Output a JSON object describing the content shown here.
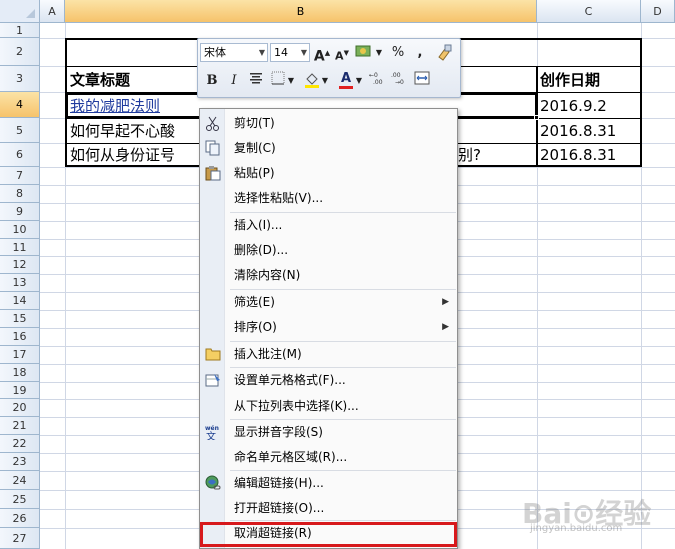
{
  "columns": [
    "A",
    "B",
    "C",
    "D"
  ],
  "selected_column": "B",
  "rows": [
    "1",
    "2",
    "3",
    "4",
    "5",
    "6",
    "7",
    "8",
    "9",
    "10",
    "11",
    "12",
    "13",
    "14",
    "15",
    "16",
    "17",
    "18",
    "19",
    "20",
    "21",
    "22",
    "23",
    "24",
    "25",
    "26",
    "27"
  ],
  "selected_row": "4",
  "table": {
    "header_title": "文章标题",
    "header_date": "创作日期",
    "rows": [
      {
        "title": "我的减肥法则",
        "date": "2016.9.2"
      },
      {
        "title": "如何早起不心酸",
        "date": "2016.8.31"
      },
      {
        "title": "如何从身份证号",
        "title_tail": "别?",
        "date": "2016.8.31"
      }
    ]
  },
  "mini_toolbar": {
    "font": "宋体",
    "size": "14",
    "grow_label": "A",
    "shrink_label": "A",
    "percent": "%",
    "comma": ",",
    "bold": "B",
    "italic": "I",
    "font_color_label": "A",
    "accent_red": "#e02020",
    "highlight_yellow": "#ffe600"
  },
  "context_menu": {
    "items": [
      {
        "label": "剪切(T)",
        "icon": "scissors-icon"
      },
      {
        "label": "复制(C)",
        "icon": "copy-icon"
      },
      {
        "label": "粘贴(P)",
        "icon": "paste-icon"
      },
      {
        "label": "选择性粘贴(V)..."
      },
      {
        "label": "插入(I)..."
      },
      {
        "label": "删除(D)..."
      },
      {
        "label": "清除内容(N)"
      },
      {
        "label": "筛选(E)",
        "submenu": true
      },
      {
        "label": "排序(O)",
        "submenu": true
      },
      {
        "label": "插入批注(M)",
        "icon": "comment-icon"
      },
      {
        "label": "设置单元格格式(F)...",
        "icon": "format-cells-icon"
      },
      {
        "label": "从下拉列表中选择(K)..."
      },
      {
        "label": "显示拼音字段(S)",
        "icon": "phonetic-icon"
      },
      {
        "label": "命名单元格区域(R)..."
      },
      {
        "label": "编辑超链接(H)...",
        "icon": "hyperlink-icon"
      },
      {
        "label": "打开超链接(O)..."
      },
      {
        "label": "取消超链接(R)"
      }
    ]
  },
  "watermark": {
    "text": "Bai⊙经验",
    "sub": "jingyan.baidu.com"
  },
  "colors": {
    "highlight_border": "#d7191c",
    "link": "#1f3b9e"
  }
}
